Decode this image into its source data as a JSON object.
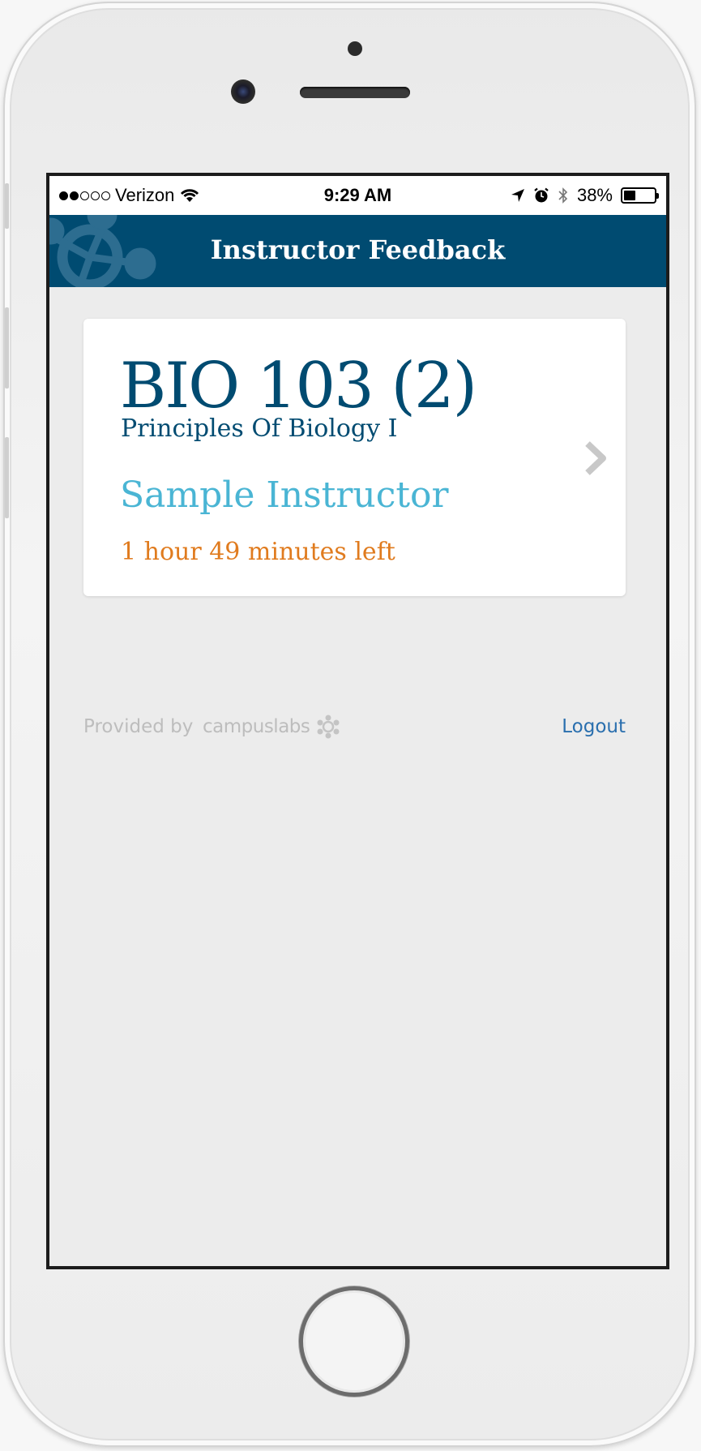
{
  "status_bar": {
    "carrier": "Verizon",
    "time": "9:29 AM",
    "battery_percent": "38%",
    "battery_level": 0.38,
    "signal_bars_filled": 2,
    "signal_bars_total": 5,
    "icons": [
      "wifi-icon",
      "location-arrow-icon",
      "alarm-icon",
      "bluetooth-icon",
      "battery-icon"
    ]
  },
  "header": {
    "title": "Instructor Feedback",
    "background_color": "#004b71"
  },
  "course_card": {
    "course_code": "BIO 103 (2)",
    "course_name": "Principles Of Biology I",
    "instructor": "Sample Instructor",
    "time_left": "1 hour 49 minutes left",
    "colors": {
      "course": "#004b71",
      "instructor": "#4ab5d4",
      "time_left": "#e07b1e"
    }
  },
  "footer": {
    "provided_by": "Provided by",
    "brand": "campuslabs",
    "logout_label": "Logout"
  }
}
